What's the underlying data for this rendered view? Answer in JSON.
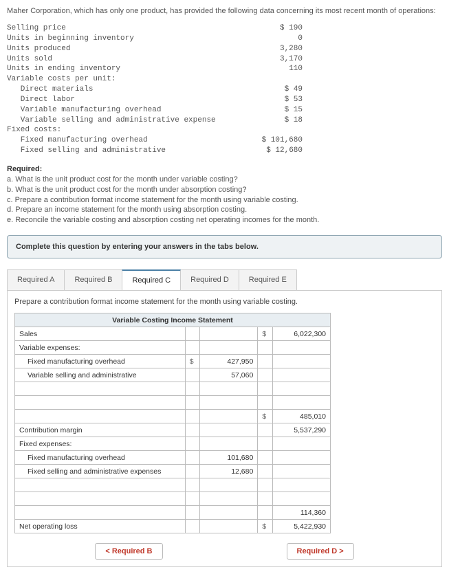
{
  "intro": "Maher Corporation, which has only one product, has provided the following data concerning its most recent month of operations:",
  "op_data": [
    {
      "pad": "",
      "label": "Selling price",
      "value": "$ 190"
    },
    {
      "pad": "",
      "label": "Units in beginning inventory",
      "value": "0"
    },
    {
      "pad": "",
      "label": "Units produced",
      "value": "3,280"
    },
    {
      "pad": "",
      "label": "Units sold",
      "value": "3,170"
    },
    {
      "pad": "",
      "label": "Units in ending inventory",
      "value": "110"
    },
    {
      "pad": "",
      "label": "Variable costs per unit:",
      "value": ""
    },
    {
      "pad": "   ",
      "label": "Direct materials",
      "value": "$ 49"
    },
    {
      "pad": "   ",
      "label": "Direct labor",
      "value": "$ 53"
    },
    {
      "pad": "   ",
      "label": "Variable manufacturing overhead",
      "value": "$ 15"
    },
    {
      "pad": "   ",
      "label": "Variable selling and administrative expense",
      "value": "$ 18"
    },
    {
      "pad": "",
      "label": "Fixed costs:",
      "value": ""
    },
    {
      "pad": "   ",
      "label": "Fixed manufacturing overhead",
      "value": "$ 101,680"
    },
    {
      "pad": "   ",
      "label": "Fixed selling and administrative",
      "value": "$ 12,680"
    }
  ],
  "req_header": "Required:",
  "req_items": [
    "a. What is the unit product cost for the month under variable costing?",
    "b. What is the unit product cost for the month under absorption costing?",
    "c. Prepare a contribution format income statement for the month using variable costing.",
    "d. Prepare an income statement for the month using absorption costing.",
    "e. Reconcile the variable costing and absorption costing net operating incomes for the month."
  ],
  "box_instruction": "Complete this question by entering your answers in the tabs below.",
  "tabs": {
    "a": "Required A",
    "b": "Required B",
    "c": "Required C",
    "d": "Required D",
    "e": "Required E"
  },
  "panel_prompt": "Prepare a contribution format income statement for the month using variable costing.",
  "stmt_header": "Variable Costing Income Statement",
  "rows": {
    "sales": {
      "label": "Sales",
      "cur2": "$",
      "val2": "6,022,300"
    },
    "var_exp_hdr": {
      "label": "Variable expenses:"
    },
    "fmo": {
      "label": "Fixed manufacturing overhead",
      "cur1": "$",
      "val1": "427,950"
    },
    "vsa": {
      "label": "Variable selling and administrative",
      "val1": "57,060"
    },
    "sub1": {
      "cur2": "$",
      "val2": "485,010"
    },
    "cm": {
      "label": "Contribution margin",
      "val2": "5,537,290"
    },
    "fixed_hdr": {
      "label": "Fixed expenses:"
    },
    "fmo2": {
      "label": "Fixed manufacturing overhead",
      "val1": "101,680"
    },
    "fsa": {
      "label": "Fixed selling and administrative expenses",
      "val1": "12,680"
    },
    "sub2": {
      "val2": "114,360"
    },
    "net": {
      "label": "Net operating loss",
      "cur2": "$",
      "val2": "5,422,930"
    }
  },
  "nav": {
    "prev": "< Required B",
    "next": "Required D >"
  }
}
